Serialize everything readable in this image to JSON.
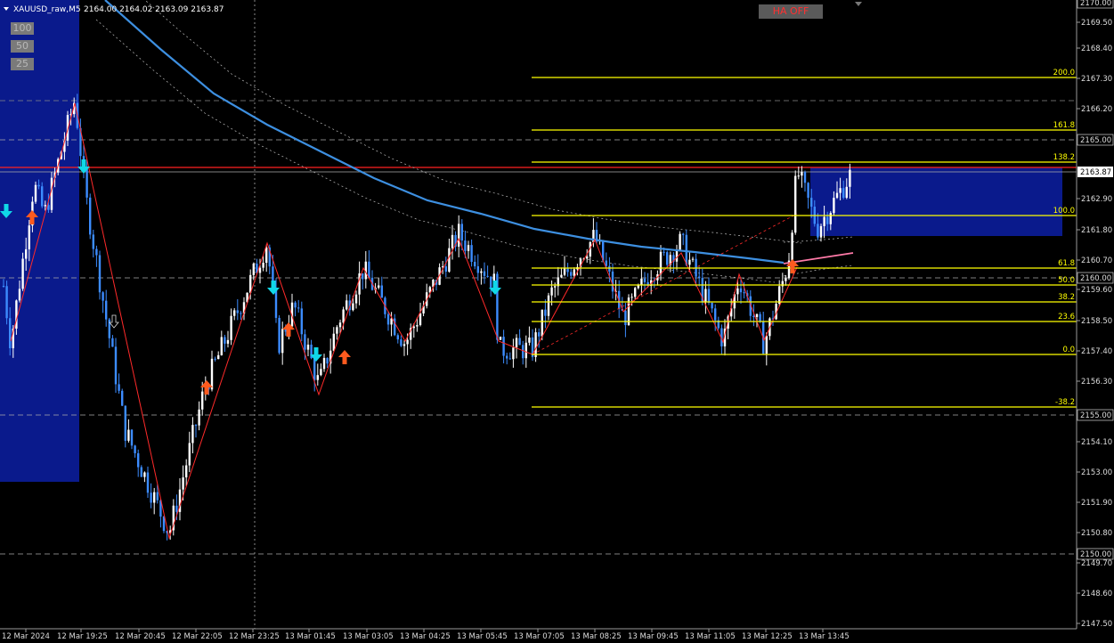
{
  "chart_header": {
    "symbol_label": "XAUUSD_raw,M5",
    "ohlc": "2164.00 2164.02 2163.09 2163.87"
  },
  "buttons": {
    "ha": "HA OFF",
    "zoom": [
      "100",
      "50",
      "25"
    ]
  },
  "colors": {
    "background": "#000000",
    "bull": "#ffffff",
    "bear": "#3c8cff",
    "ma": "#3d8fe0",
    "zigzag": "#ff2a2a",
    "fib": "#ffff00",
    "zone": "#0a1a8c",
    "price_line": "#ff2020",
    "arrow_up": "#ff5a1e",
    "arrow_down": "#10d8e8"
  },
  "price_axis": {
    "ticks": [
      "2170.00",
      "2169.50",
      "2168.40",
      "2167.30",
      "2166.20",
      "2165.00",
      "2163.87",
      "2162.90",
      "2161.80",
      "2160.70",
      "2160.00",
      "2159.60",
      "2158.50",
      "2157.40",
      "2156.30",
      "2155.00",
      "2154.10",
      "2153.00",
      "2151.90",
      "2150.80",
      "2150.00",
      "2149.70",
      "2148.60",
      "2147.50"
    ],
    "current_price": "2163.87"
  },
  "time_axis": [
    "12 Mar 2024",
    "12 Mar 19:25",
    "12 Mar 20:45",
    "12 Mar 22:05",
    "12 Mar 23:25",
    "13 Mar 01:45",
    "13 Mar 03:05",
    "13 Mar 04:25",
    "13 Mar 05:45",
    "13 Mar 07:05",
    "13 Mar 08:25",
    "13 Mar 09:45",
    "13 Mar 11:05",
    "13 Mar 12:25",
    "13 Mar 13:45"
  ],
  "fib_levels": [
    {
      "label": "200.0"
    },
    {
      "label": "161.8"
    },
    {
      "label": "138.2"
    },
    {
      "label": "100.0"
    },
    {
      "label": "61.8"
    },
    {
      "label": "50.0"
    },
    {
      "label": "38.2"
    },
    {
      "label": "23.6"
    },
    {
      "label": "0.0"
    },
    {
      "label": "-38.2"
    }
  ]
}
